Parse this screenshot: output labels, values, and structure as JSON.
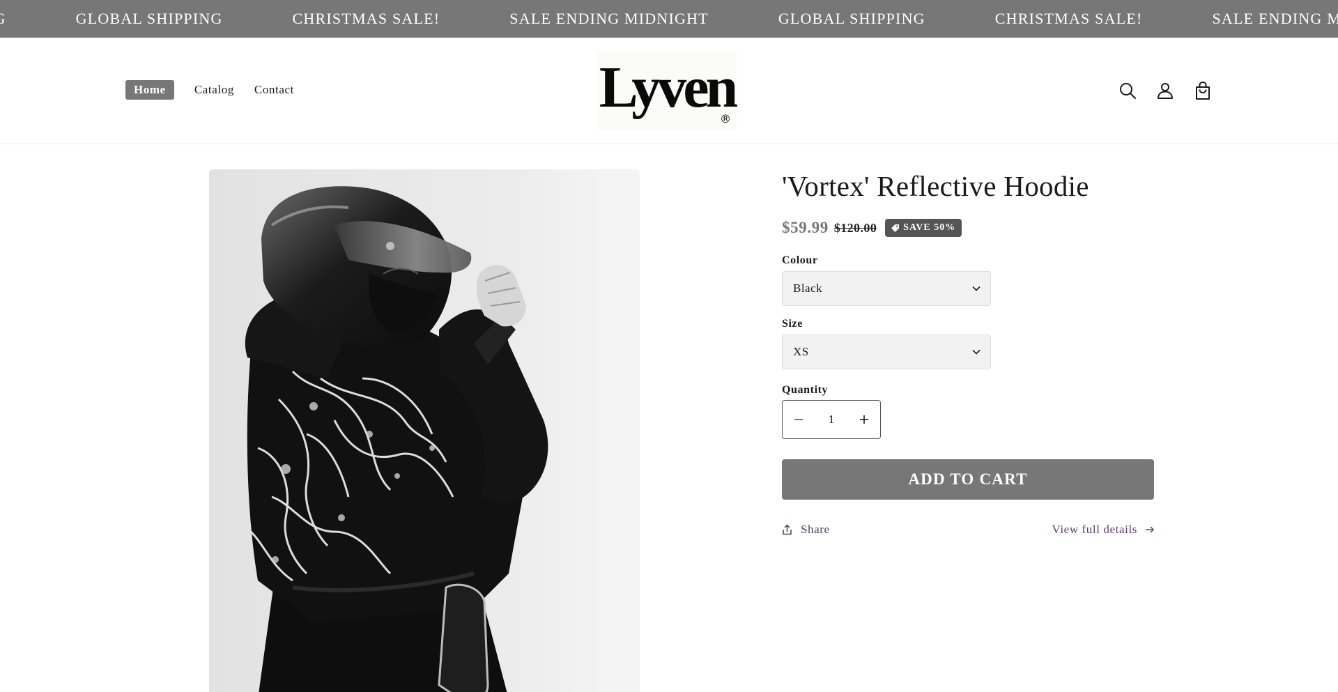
{
  "announcement": {
    "items": [
      "SHIPPING",
      "GLOBAL SHIPPING",
      "CHRISTMAS SALE!",
      "SALE ENDING MIDNIGHT",
      "GLOBAL SHIPPING",
      "CHRISTMAS SALE!",
      "SALE ENDING MIDNIGHT"
    ]
  },
  "header": {
    "nav": [
      "Home",
      "Catalog",
      "Contact"
    ],
    "logo_text": "Lyven",
    "logo_mark": "®",
    "icons": [
      "search-icon",
      "account-icon",
      "cart-icon"
    ]
  },
  "product": {
    "image_alt": "Model in black helmet and hoodie with white splatter print",
    "title": "'Vortex' Reflective Hoodie",
    "price_sale": "$59.99",
    "price_regular": "$120.00",
    "badge": "SAVE 50%",
    "colour_label": "Colour",
    "colour_value": "Black",
    "size_label": "Size",
    "size_value": "XS",
    "quantity_label": "Quantity",
    "quantity_value": "1",
    "add_to_cart": "ADD TO CART",
    "share": "Share",
    "view_details": "View full details"
  },
  "colors": {
    "accent": "#777777",
    "badge": "#555555",
    "link": "#5a3f75"
  }
}
